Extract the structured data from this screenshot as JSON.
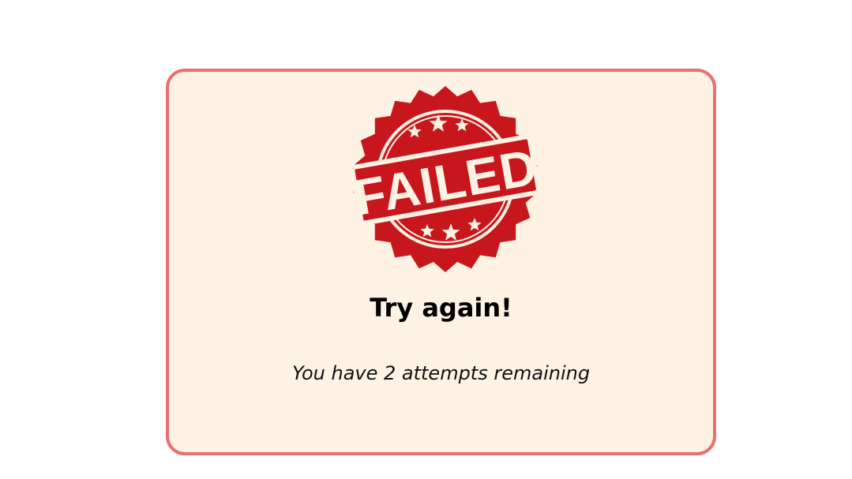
{
  "stamp": {
    "text": "FAILED",
    "color": "#c8161d"
  },
  "result": {
    "title": "Try again!",
    "attempts_message": "You have 2 attempts remaining"
  },
  "colors": {
    "card_background": "#fdf2e3",
    "card_border": "#ec6e70"
  }
}
